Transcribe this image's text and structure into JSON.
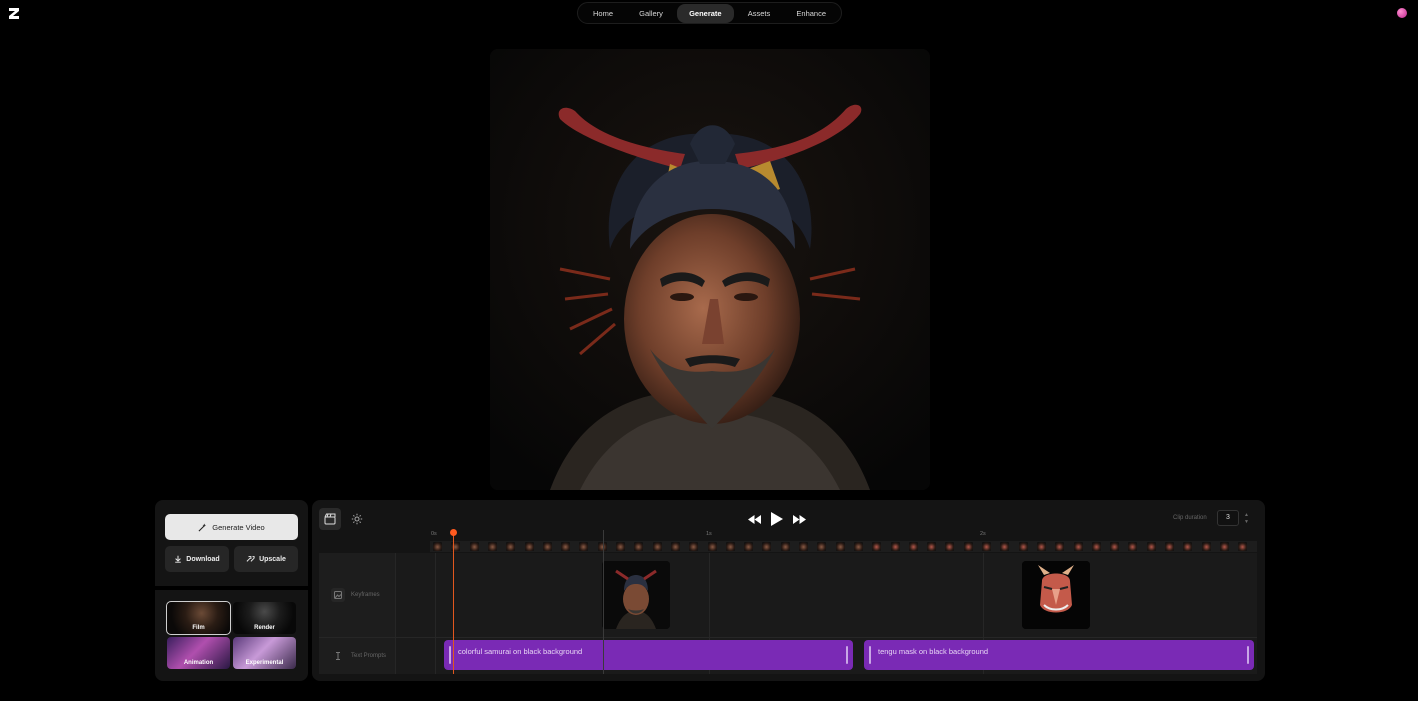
{
  "nav": {
    "items": [
      {
        "label": "Home",
        "active": false
      },
      {
        "label": "Gallery",
        "active": false
      },
      {
        "label": "Generate",
        "active": true
      },
      {
        "label": "Assets",
        "active": false
      },
      {
        "label": "Enhance",
        "active": false
      }
    ]
  },
  "actions": {
    "generate_video": "Generate Video",
    "download": "Download",
    "upscale": "Upscale"
  },
  "styles": [
    {
      "label": "Film",
      "selected": true
    },
    {
      "label": "Render",
      "selected": false
    },
    {
      "label": "Animation",
      "selected": false
    },
    {
      "label": "Experimental",
      "selected": false
    }
  ],
  "timeline": {
    "clip_duration_label": "Clip duration",
    "clip_duration_value": "3",
    "ruler": [
      "0s",
      "1s",
      "2s"
    ],
    "tracks": {
      "keyframes_label": "Keyframes",
      "prompts_label": "Text Prompts"
    },
    "prompts": [
      {
        "text": "colorful samurai on black background"
      },
      {
        "text": "tengu mask on black background"
      }
    ]
  },
  "colors": {
    "accent": "#7a2ab5",
    "playhead": "#ff5a1f",
    "avatar": "#d43aa8"
  },
  "icons": [
    "logo-icon",
    "magic-wand-icon",
    "download-icon",
    "upscale-icon",
    "clapper-icon",
    "gear-icon",
    "rewind-icon",
    "play-icon",
    "fast-forward-icon",
    "image-icon",
    "text-cursor-icon"
  ]
}
